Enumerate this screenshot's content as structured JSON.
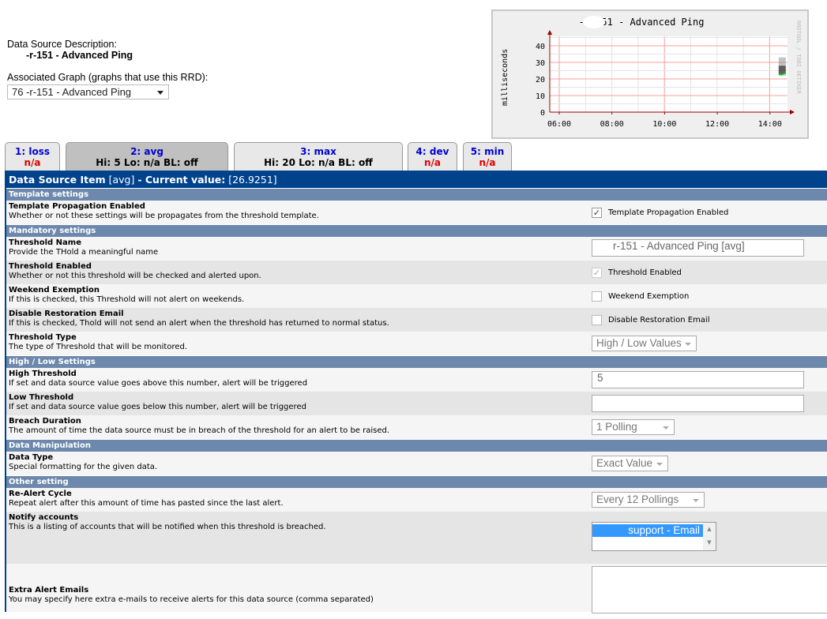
{
  "header": {
    "desc_label": "Data Source Description:",
    "desc_value": "-r-151 - Advanced Ping",
    "assoc_label": "Associated Graph (graphs that use this RRD):",
    "assoc_value": "76        -r-151 - Advanced Ping"
  },
  "graph": {
    "title": "-r-151 - Advanced Ping",
    "ylabel": "milliseconds",
    "watermark": "RRDTOOL / TOBI OETIKER",
    "yticks": [
      "0",
      "10",
      "20",
      "30",
      "40"
    ],
    "xticks": [
      "06:00",
      "08:00",
      "10:00",
      "12:00",
      "14:00"
    ],
    "ylim": [
      0,
      40
    ],
    "colors": {
      "grid": "#f4a0a0",
      "avg": "#00cc00",
      "spread": "#333333"
    }
  },
  "tabs": [
    {
      "name": "1: loss",
      "value": "n/a"
    },
    {
      "name": "2: avg",
      "value": "Hi: 5 Lo: n/a BL: off",
      "active": true
    },
    {
      "name": "3: max",
      "value": "Hi: 20 Lo: n/a BL: off"
    },
    {
      "name": "4: dev",
      "value": "n/a"
    },
    {
      "name": "5: min",
      "value": "n/a"
    }
  ],
  "panel": {
    "title": "Data Source Item",
    "item": "[avg]",
    "current_label": "- Current value:",
    "current_value": "[26.9251]"
  },
  "sections": {
    "template": "Template settings",
    "mandatory": "Mandatory settings",
    "highlow": "High / Low Settings",
    "manip": "Data Manipulation",
    "other": "Other setting"
  },
  "fields": {
    "propagation": {
      "title": "Template Propagation Enabled",
      "desc": "Whether or not these settings will be propagates from the threshold template.",
      "label": "Template Propagation Enabled",
      "checked": true
    },
    "name": {
      "title": "Threshold Name",
      "desc": "Provide the THold a meaningful name",
      "value": "r-151 -  Advanced Ping [avg]"
    },
    "enabled": {
      "title": "Threshold Enabled",
      "desc": "Whether or not this threshold will be checked and alerted upon.",
      "label": "Threshold Enabled",
      "checked": true
    },
    "weekend": {
      "title": "Weekend Exemption",
      "desc": "If this is checked, this Threshold will not alert on weekends.",
      "label": "Weekend Exemption",
      "checked": false
    },
    "restoration": {
      "title": "Disable Restoration Email",
      "desc": "If this is checked, Thold will not send an alert when the threshold has returned to normal status.",
      "label": "Disable Restoration Email",
      "checked": false
    },
    "type": {
      "title": "Threshold Type",
      "desc": "The type of Threshold that will be monitored.",
      "value": "High / Low Values"
    },
    "high": {
      "title": "High Threshold",
      "desc": "If set and data source value goes above this number, alert will be triggered",
      "value": "5"
    },
    "low": {
      "title": "Low Threshold",
      "desc": "If set and data source value goes below this number, alert will be triggered",
      "value": ""
    },
    "breach": {
      "title": "Breach Duration",
      "desc": "The amount of time the data source must be in breach of the threshold for an alert to be raised.",
      "value": "1 Polling"
    },
    "datatype": {
      "title": "Data Type",
      "desc": "Special formatting for the given data.",
      "value": "Exact Value"
    },
    "realert": {
      "title": "Re-Alert Cycle",
      "desc": "Repeat alert after this amount of time has pasted since the last alert.",
      "value": "Every 12 Pollings"
    },
    "notify": {
      "title": "Notify accounts",
      "desc": "This is a listing of accounts that will be notified when this threshold is breached.",
      "selected": "support - Email"
    },
    "extra": {
      "title": "Extra Alert Emails",
      "desc": "You may specify here extra e-mails to receive alerts for this data source (comma separated)",
      "value": ""
    }
  }
}
